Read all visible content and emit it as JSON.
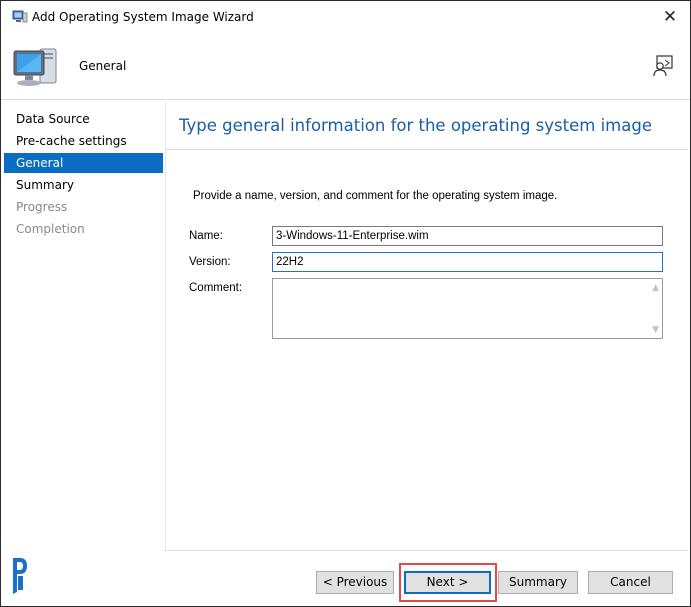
{
  "window": {
    "title": "Add Operating System Image Wizard"
  },
  "header": {
    "title": "General"
  },
  "nav": {
    "items": [
      {
        "label": "Data Source",
        "state": "normal"
      },
      {
        "label": "Pre-cache settings",
        "state": "normal"
      },
      {
        "label": "General",
        "state": "selected"
      },
      {
        "label": "Summary",
        "state": "normal"
      },
      {
        "label": "Progress",
        "state": "disabled"
      },
      {
        "label": "Completion",
        "state": "disabled"
      }
    ]
  },
  "content": {
    "heading": "Type general information for the operating system image",
    "intro": "Provide a name, version, and comment for the operating system image.",
    "fields": {
      "name_label": "Name:",
      "name_value": "3-Windows-11-Enterprise.wim",
      "version_label": "Version:",
      "version_value": "22H2",
      "comment_label": "Comment:",
      "comment_value": ""
    }
  },
  "footer": {
    "previous_label": "< Previous",
    "next_label": "Next >",
    "summary_label": "Summary",
    "cancel_label": "Cancel"
  },
  "colors": {
    "accent": "#0b6cc4",
    "heading": "#1a5ea8",
    "highlight": "#e04a4a",
    "disabled_text": "#8a8a8a"
  }
}
